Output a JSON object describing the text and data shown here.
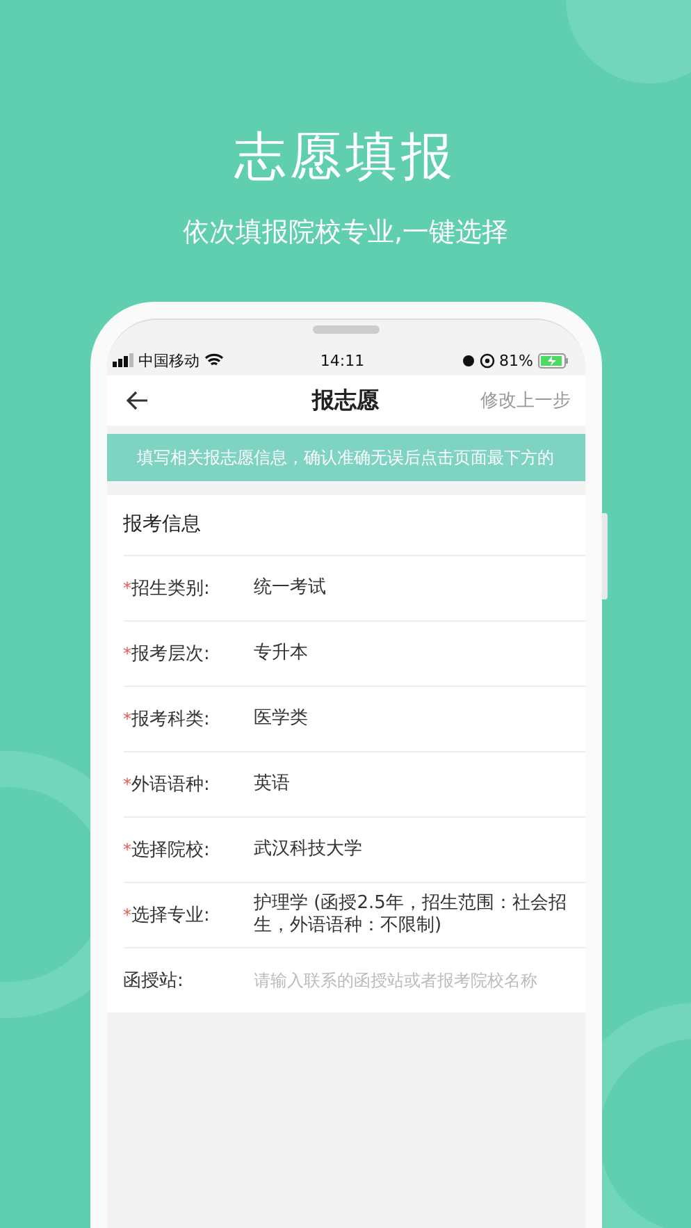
{
  "promo": {
    "title": "志愿填报",
    "subtitle": "依次填报院校专业,一键选择"
  },
  "status_bar": {
    "carrier": "中国移动",
    "time": "14:11",
    "battery": "81%"
  },
  "nav": {
    "title": "报志愿",
    "action": "修改上一步"
  },
  "notice": "填写相关报志愿信息，确认准确无误后点击页面最下方的",
  "form": {
    "section_title": "报考信息",
    "fields": [
      {
        "kind": "text",
        "required_mark": "*",
        "label": "招生类别:",
        "value": "统一考试"
      },
      {
        "kind": "text",
        "required_mark": "*",
        "label": "报考层次:",
        "value": "专升本"
      },
      {
        "kind": "text",
        "required_mark": "*",
        "label": "报考科类:",
        "value": "医学类"
      },
      {
        "kind": "text",
        "required_mark": "*",
        "label": "外语语种:",
        "value": "英语"
      },
      {
        "kind": "text",
        "required_mark": "*",
        "label": "选择院校:",
        "value": "武汉科技大学"
      },
      {
        "kind": "text",
        "required_mark": "*",
        "label": "选择专业:",
        "value": "护理学 (函授2.5年，招生范围：社会招生，外语语种：不限制)"
      },
      {
        "kind": "input",
        "label": "函授站:",
        "placeholder": "请输入联系的函授站或者报考院校名称"
      }
    ]
  }
}
